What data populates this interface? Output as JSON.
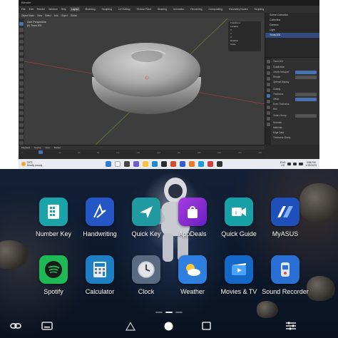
{
  "blender": {
    "title": "Blender",
    "menus": [
      "File",
      "Edit",
      "Render",
      "Window",
      "Help"
    ],
    "workspaces": [
      "Layout",
      "Modeling",
      "Sculpting",
      "UV Editing",
      "Texture Paint",
      "Shading",
      "Animation",
      "Rendering",
      "Compositing",
      "Geometry Nodes",
      "Scripting"
    ],
    "active_workspace": "Layout",
    "header_items": [
      "Object Mode",
      "View",
      "Select",
      "Add",
      "Object",
      "Global"
    ],
    "viewport": {
      "label_line1": "User Perspective",
      "label_line2": "(0) Torus.001"
    },
    "outliner": {
      "rows": [
        "Scene Collection",
        "Collection",
        "Camera",
        "Light",
        "Torus.001"
      ],
      "selected_index": 4
    },
    "properties": {
      "rows": [
        "Torus.001",
        "Subdivision",
        "Levels Viewport",
        "Render",
        "Optimal Display",
        "Solidify",
        "Thickness",
        "Offset",
        "Even Thickness",
        "Rim",
        "Vertex Group",
        "Normals",
        "Materials",
        "Edge Data",
        "Thickness Clamp"
      ]
    },
    "n_panel": {
      "rows": [
        "Transform",
        "Location",
        "X",
        "Y",
        "Z",
        "Rotation",
        "Scale"
      ]
    },
    "timeline": {
      "items": [
        "Playback",
        "Keying",
        "View",
        "Marker"
      ],
      "ticks": [
        "0",
        "20",
        "40",
        "60",
        "80",
        "100",
        "120",
        "140",
        "160",
        "180",
        "200",
        "220",
        "240"
      ]
    }
  },
  "taskbar": {
    "weather_temp": "29°C",
    "weather_desc": "Mostly cloudy",
    "tray_lang": "ENG",
    "tray_region": "US",
    "time": "3:08 PM",
    "date": "1/15/2023"
  },
  "launcher": {
    "row1": [
      {
        "label": "Number Key",
        "icon": "number-key-icon",
        "color": "#1aa3a8"
      },
      {
        "label": "Handwriting",
        "icon": "handwriting-icon",
        "color": "#2457c5"
      },
      {
        "label": "Quick Key",
        "icon": "quick-key-icon",
        "color": "#1e9aa0"
      },
      {
        "label": "AppDeals",
        "icon": "app-deals-icon",
        "color": "#8a2bd6"
      },
      {
        "label": "Quick Guide",
        "icon": "quick-guide-icon",
        "color": "#16a0a8"
      },
      {
        "label": "MyASUS",
        "icon": "myasus-icon",
        "color": "#1f4fb8"
      }
    ],
    "row2": [
      {
        "label": "Spotify",
        "icon": "spotify-icon",
        "color": "#1db954"
      },
      {
        "label": "Calculator",
        "icon": "calculator-icon",
        "color": "#1f7fc4"
      },
      {
        "label": "Clock",
        "icon": "clock-icon",
        "color": "#e0e3e8"
      },
      {
        "label": "Weather",
        "icon": "weather-icon",
        "color": "#2f7fe0"
      },
      {
        "label": "Movies & TV",
        "icon": "movies-tv-icon",
        "color": "#1267c7"
      },
      {
        "label": "Sound Recorder",
        "icon": "sound-recorder-icon",
        "color": "#2a6fd4"
      }
    ]
  },
  "navbar": {
    "buttons": [
      "link-icon",
      "keyboard-icon",
      "triangle-icon",
      "home-circle-icon",
      "square-icon",
      "settings-sliders-icon"
    ]
  }
}
